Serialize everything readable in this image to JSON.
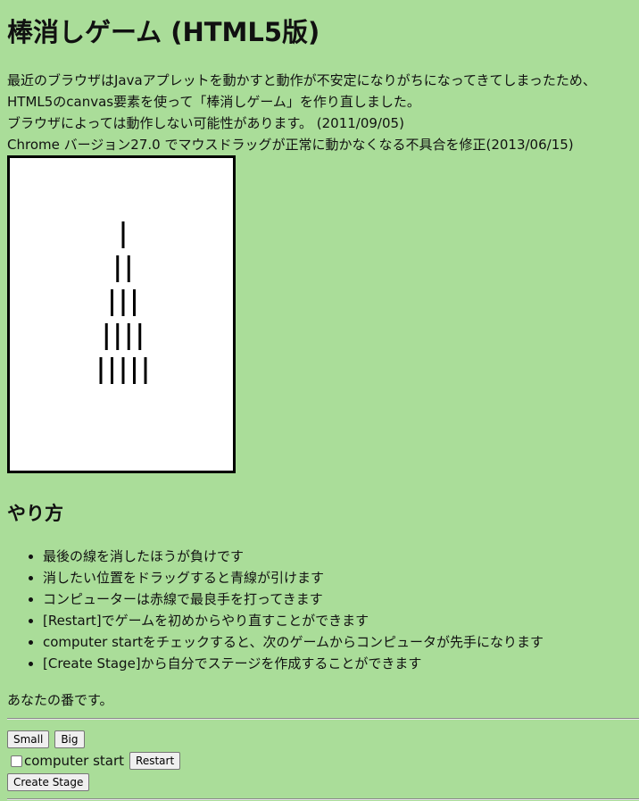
{
  "page": {
    "title": "棒消しゲーム (HTML5版)"
  },
  "intro": {
    "line1": "最近のブラウザはJavaアプレットを動かすと動作が不安定になりがちになってきてしまったため、",
    "line2": "HTML5のcanvas要素を使って「棒消しゲーム」を作り直しました。",
    "line3": "ブラウザによっては動作しない可能性があります。 (2011/09/05)",
    "line4": "Chrome バージョン27.0 でマウスドラッグが正常に動かなくなる不具合を修正(2013/06/15)"
  },
  "board": {
    "rows": [
      1,
      2,
      3,
      4,
      5
    ],
    "background": "#ffffff",
    "stick_color": "#000000"
  },
  "howto": {
    "heading": "やり方",
    "items": [
      "最後の線を消したほうが負けです",
      "消したい位置をドラッグすると青線が引けます",
      "コンピューターは赤線で最良手を打ってきます",
      "[Restart]でゲームを初めからやり直すことができます",
      "computer startをチェックすると、次のゲームからコンピュータが先手になります",
      "[Create Stage]から自分でステージを作成することができます"
    ]
  },
  "status": {
    "message": "あなたの番です。"
  },
  "controls": {
    "small_label": "Small",
    "big_label": "Big",
    "computer_start_label": "computer start",
    "computer_start_checked": false,
    "restart_label": "Restart",
    "create_stage_label": "Create Stage"
  },
  "colors": {
    "page_background": "#aadd99"
  }
}
